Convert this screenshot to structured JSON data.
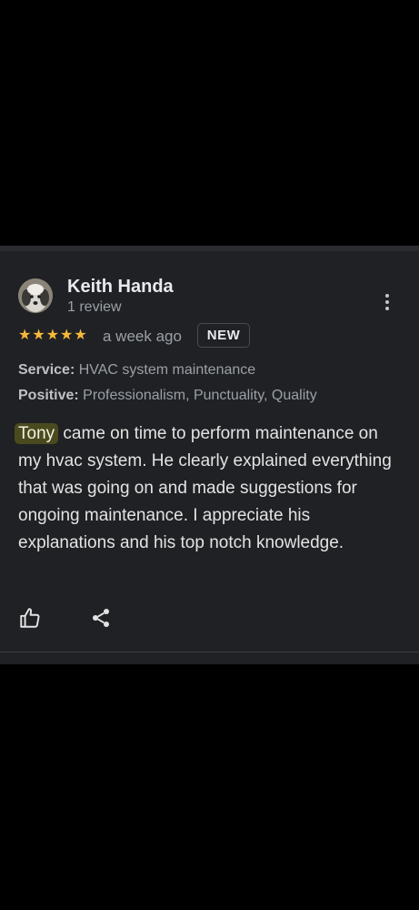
{
  "review": {
    "author_name": "Keith Handa",
    "review_count": "1 review",
    "rating": 5,
    "stars": [
      "★",
      "★",
      "★",
      "★",
      "★"
    ],
    "date": "a week ago",
    "badge": "NEW",
    "service_label": "Service:",
    "service_value": "HVAC system maintenance",
    "positive_label": "Positive:",
    "positive_value": "Professionalism, Punctuality, Quality",
    "highlight": "Tony",
    "text_rest": "came on time to perform maintenance on my hvac system. He clearly explained everything that was going on and made suggestions for ongoing maintenance. I appreciate his explanations and his top notch knowledge."
  },
  "icons": {
    "avatar": "dog-avatar",
    "more": "more-vert-icon",
    "like": "thumbs-up-icon",
    "share": "share-icon"
  },
  "colors": {
    "background": "#000000",
    "card": "#202124",
    "star": "#f5b93a",
    "highlight": "#4a4a1f"
  }
}
